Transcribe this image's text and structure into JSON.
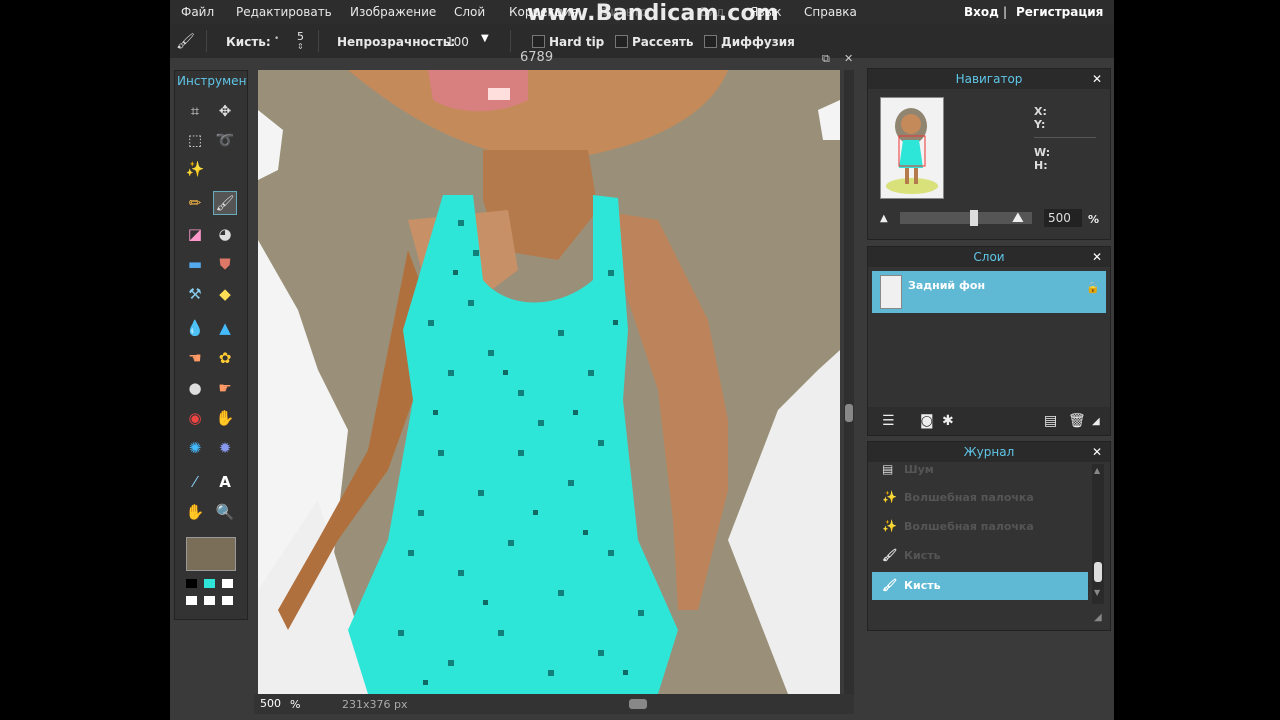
{
  "menu": {
    "items": [
      "Файл",
      "Редактировать",
      "Изображение",
      "Слой",
      "Коррекция",
      "Фильтр",
      "Вид",
      "Язык",
      "Справка"
    ],
    "login": "Вход",
    "separator": "|",
    "register": "Регистрация"
  },
  "watermark": "www.Bandicam.com",
  "options": {
    "brush_label": "Кисть:",
    "brush_size": "5",
    "opacity_label": "Непрозрачность:",
    "opacity_value": "100",
    "hard_tip": "Hard tip",
    "scatter": "Рассеять",
    "diffusion": "Диффузия"
  },
  "tools": {
    "title": "Инструменты"
  },
  "document": {
    "title": "6789",
    "zoom": "500",
    "zoom_unit": "%",
    "size": "231x376 px"
  },
  "navigator": {
    "title": "Навигатор",
    "x_label": "X:",
    "y_label": "Y:",
    "w_label": "W:",
    "h_label": "H:",
    "zoom_value": "500",
    "zoom_unit": "%"
  },
  "layers": {
    "title": "Слои",
    "items": [
      {
        "name": "Задний фон"
      }
    ]
  },
  "history": {
    "title": "Журнал",
    "items": [
      {
        "label": "Шум"
      },
      {
        "label": "Волшебная палочка"
      },
      {
        "label": "Волшебная палочка"
      },
      {
        "label": "Кисть"
      },
      {
        "label": "Кисть"
      }
    ]
  },
  "colors": {
    "accent": "#5fb8d4",
    "foreground": "#7a6e58",
    "dress": "#2ee6d8",
    "skin": "#c08a5a",
    "hair": "#9a9079"
  }
}
